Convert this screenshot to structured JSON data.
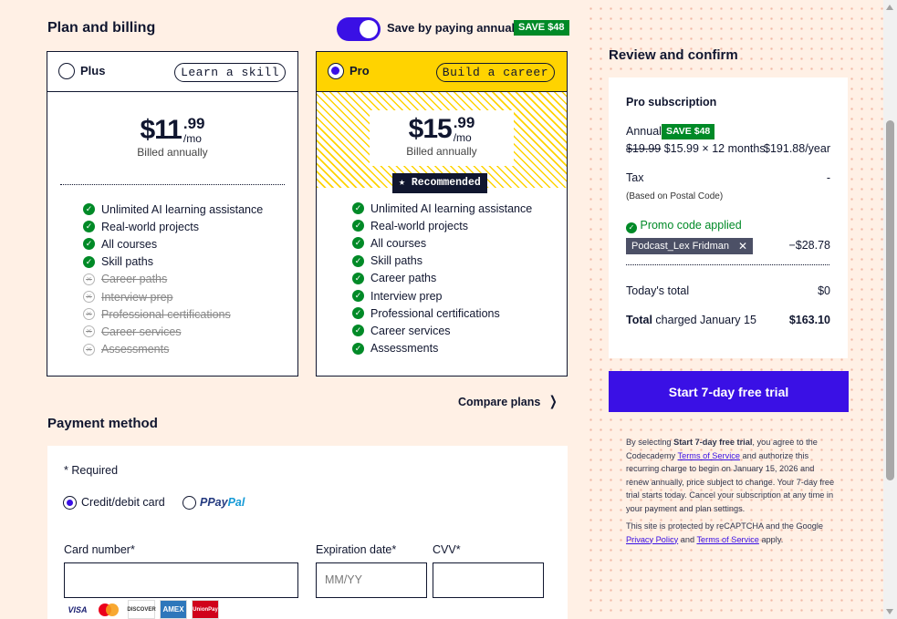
{
  "plan_billing": {
    "title": "Plan and billing",
    "annual_toggle_label": "Save by paying annually",
    "save_badge": "SAVE $48"
  },
  "plans": [
    {
      "name": "Plus",
      "tag": "Learn a skill",
      "dollars": "$11",
      "cents": ".99",
      "per": "/mo",
      "billed": "Billed annually",
      "selected": false,
      "features": [
        {
          "label": "Unlimited AI learning assistance",
          "included": true
        },
        {
          "label": "Real-world projects",
          "included": true
        },
        {
          "label": "All courses",
          "included": true
        },
        {
          "label": "Skill paths",
          "included": true
        },
        {
          "label": "Career paths",
          "included": false
        },
        {
          "label": "Interview prep",
          "included": false
        },
        {
          "label": "Professional certifications",
          "included": false
        },
        {
          "label": "Career services",
          "included": false
        },
        {
          "label": "Assessments",
          "included": false
        }
      ]
    },
    {
      "name": "Pro",
      "tag": "Build a career",
      "dollars": "$15",
      "cents": ".99",
      "per": "/mo",
      "billed": "Billed annually",
      "recommended": "Recommended",
      "selected": true,
      "features": [
        {
          "label": "Unlimited AI learning assistance",
          "included": true
        },
        {
          "label": "Real-world projects",
          "included": true
        },
        {
          "label": "All courses",
          "included": true
        },
        {
          "label": "Skill paths",
          "included": true
        },
        {
          "label": "Career paths",
          "included": true
        },
        {
          "label": "Interview prep",
          "included": true
        },
        {
          "label": "Professional certifications",
          "included": true
        },
        {
          "label": "Career services",
          "included": true
        },
        {
          "label": "Assessments",
          "included": true
        }
      ]
    }
  ],
  "compare_plans": "Compare plans",
  "payment": {
    "title": "Payment method",
    "required_note": "* Required",
    "method_card": "Credit/debit card",
    "method_paypal_pay": "Pay",
    "method_paypal_pal": "Pal",
    "card_number_label": "Card number*",
    "expiration_label": "Expiration date*",
    "expiration_placeholder": "MM/YY",
    "cvv_label": "CVV*",
    "card_brands": [
      "VISA",
      "MC",
      "DISCOVER",
      "AMEX",
      "UnionPay"
    ]
  },
  "review": {
    "title": "Review and confirm",
    "subscription_title": "Pro subscription",
    "annual_label": "Annual",
    "annual_badge": "SAVE $48",
    "old_price": "$19.99",
    "price_detail": "$15.99 × 12 months",
    "price_year": "$191.88/year",
    "tax_label": "Tax",
    "tax_value": "-",
    "tax_note": "(Based on Postal Code)",
    "promo_applied": "Promo code applied",
    "promo_code": "Podcast_Lex Fridman",
    "promo_discount": "−$28.78",
    "today_label": "Today's total",
    "today_value": "$0",
    "total_label_bold": "Total",
    "total_label_rest": " charged January 15",
    "total_value": "$163.10",
    "cta": "Start 7-day free trial"
  },
  "legal": {
    "p1_pre": "By selecting ",
    "p1_bold": "Start 7-day free trial",
    "p1_mid": ", you agree to the Codecademy ",
    "p1_link": "Terms of Service",
    "p1_post": " and authorize this recurring charge to begin on January 15, 2026 and renew annually, price subject to change. Your 7-day free trial starts today. Cancel your subscription at any time in your payment and plan settings.",
    "p2_pre": "This site is protected by reCAPTCHA and the Google ",
    "p2_link1": "Privacy Policy",
    "p2_mid": " and ",
    "p2_link2": "Terms of Service",
    "p2_post": " apply."
  },
  "colors": {
    "brand": "#3a10e5",
    "success": "#008a27",
    "pro_highlight": "#ffd300",
    "background": "#fff0e5",
    "text": "#10162f"
  }
}
